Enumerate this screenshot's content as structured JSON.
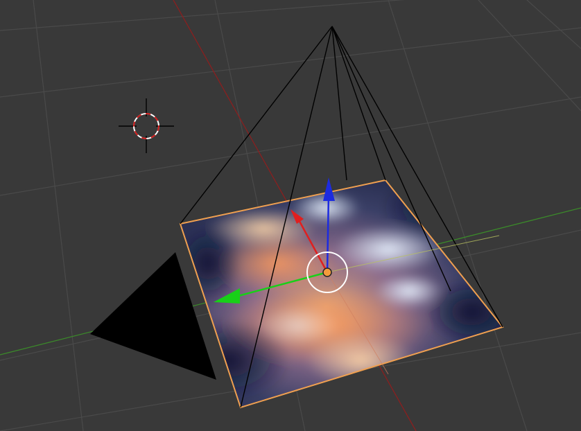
{
  "viewport": {
    "background": "#393939",
    "grid_color": "#4a4a4a",
    "x_axis_color": "#8a1f1f",
    "y_axis_color": "#3b8a2a"
  },
  "icons": {
    "cursor": "3d-cursor-icon",
    "origin": "object-origin-icon",
    "manipulator": "transform-manipulator-icon",
    "empty": "camera-empty-icon"
  },
  "colors": {
    "selection_outline": "#f0a050",
    "manipulator_x": "#e01f1f",
    "manipulator_y": "#18d018",
    "manipulator_z": "#1d2be0",
    "camera_wire": "#000000",
    "origin_fill": "#f39c3c"
  }
}
